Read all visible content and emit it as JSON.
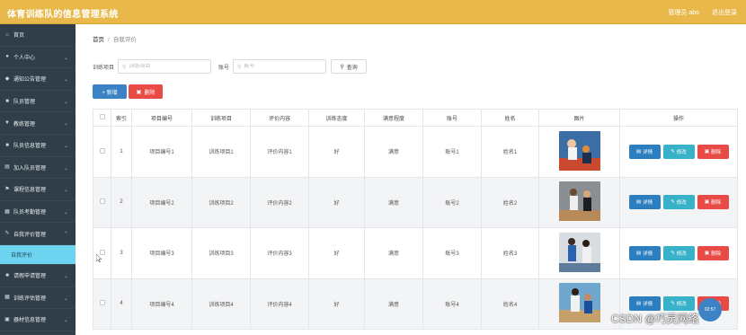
{
  "header": {
    "title": "体育训练队的信息管理系统",
    "user_label": "管理员 abo",
    "logout_label": "退出登录"
  },
  "sidebar": {
    "items": [
      {
        "label": "首页",
        "icon": "home-icon",
        "has_arrow": false
      },
      {
        "label": "个人中心",
        "icon": "user-icon",
        "has_arrow": true
      },
      {
        "label": "通知公告管理",
        "icon": "bell-icon",
        "has_arrow": true
      },
      {
        "label": "队员管理",
        "icon": "team-icon",
        "has_arrow": true
      },
      {
        "label": "教练管理",
        "icon": "coach-icon",
        "has_arrow": true
      },
      {
        "label": "队员信息管理",
        "icon": "file-icon",
        "has_arrow": true
      },
      {
        "label": "加入队员管理",
        "icon": "list-icon",
        "has_arrow": true
      },
      {
        "label": "课程信息管理",
        "icon": "flag-icon",
        "has_arrow": true
      },
      {
        "label": "队员考勤管理",
        "icon": "calendar-icon",
        "has_arrow": true
      },
      {
        "label": "自我评价管理",
        "icon": "edit-icon",
        "has_arrow": true,
        "expanded": true
      },
      {
        "label": "自我评价",
        "sub": true
      },
      {
        "label": "请假申请管理",
        "icon": "doc-icon",
        "has_arrow": true
      },
      {
        "label": "训练评估管理",
        "icon": "grid-icon",
        "has_arrow": true
      },
      {
        "label": "器材信息管理",
        "icon": "box-icon",
        "has_arrow": true
      }
    ]
  },
  "breadcrumb": {
    "home": "首页",
    "separator": "/",
    "current": "自我评价"
  },
  "search": {
    "field1_label": "训练项目",
    "field1_placeholder": "训练项目",
    "field2_label": "账号",
    "field2_placeholder": "账号",
    "query_label": "查询"
  },
  "actions": {
    "add_label": "+ 新增",
    "delete_label": "删除"
  },
  "table": {
    "columns": [
      "",
      "索引",
      "项目编号",
      "训练项目",
      "评价内容",
      "训练态度",
      "满意程度",
      "账号",
      "姓名",
      "图片",
      "操作"
    ],
    "rows": [
      {
        "index": "1",
        "code": "项目编号1",
        "project": "训练项目1",
        "content": "评价内容1",
        "attitude": "好",
        "satisfaction": "满意",
        "account": "账号1",
        "name": "姓名1"
      },
      {
        "index": "2",
        "code": "项目编号2",
        "project": "训练项目2",
        "content": "评价内容2",
        "attitude": "好",
        "satisfaction": "满意",
        "account": "账号2",
        "name": "姓名2"
      },
      {
        "index": "3",
        "code": "项目编号3",
        "project": "训练项目3",
        "content": "评价内容3",
        "attitude": "好",
        "satisfaction": "满意",
        "account": "账号3",
        "name": "姓名3"
      },
      {
        "index": "4",
        "code": "项目编号4",
        "project": "训练项目4",
        "content": "评价内容4",
        "attitude": "好",
        "satisfaction": "满意",
        "account": "账号4",
        "name": "姓名4"
      }
    ],
    "op_detail": "详情",
    "op_edit": "修改",
    "op_delete": "删除"
  },
  "overlay": {
    "bubble_text": "02:57",
    "watermark": "CSDN @巧灵网络"
  },
  "colors": {
    "header": "#e8b94a",
    "sidebar": "#2f3e48",
    "active_sub": "#6ed3ee",
    "primary": "#3c83c5",
    "danger": "#e84b46",
    "info": "#37b2c8"
  }
}
